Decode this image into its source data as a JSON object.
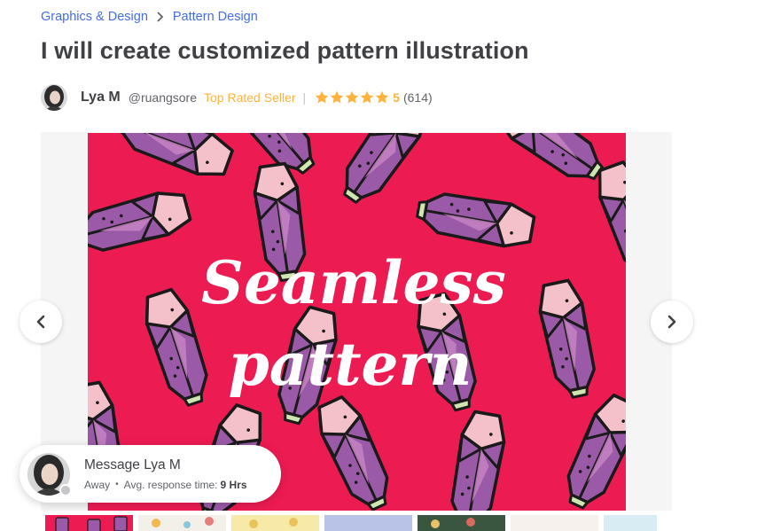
{
  "breadcrumb": {
    "items": [
      "Graphics & Design",
      "Pattern Design"
    ]
  },
  "gig": {
    "title": "I will create customized pattern illustration"
  },
  "seller": {
    "name": "Lya M",
    "handle": "@ruangsore",
    "badge": "Top Rated Seller",
    "divider": "|",
    "rating": "5",
    "reviews": "(614)",
    "stars": 5
  },
  "gallery": {
    "slide_text_line1": "Seamless",
    "slide_text_line2": "pattern",
    "prev_icon": "chevron-left-icon",
    "next_icon": "chevron-right-icon",
    "thumbnail_count": 7
  },
  "chat": {
    "title": "Message Lya M",
    "status": "Away",
    "separator": "•",
    "response_label": "Avg. response time:",
    "response_value": "9 Hrs"
  },
  "colors": {
    "link": "#446ee7",
    "star": "#ffb33e",
    "slide_bg": "#ec1b52",
    "crystal_purple": "#9b5aa8",
    "crystal_pink": "#f4c1cb",
    "text": "#404145"
  }
}
